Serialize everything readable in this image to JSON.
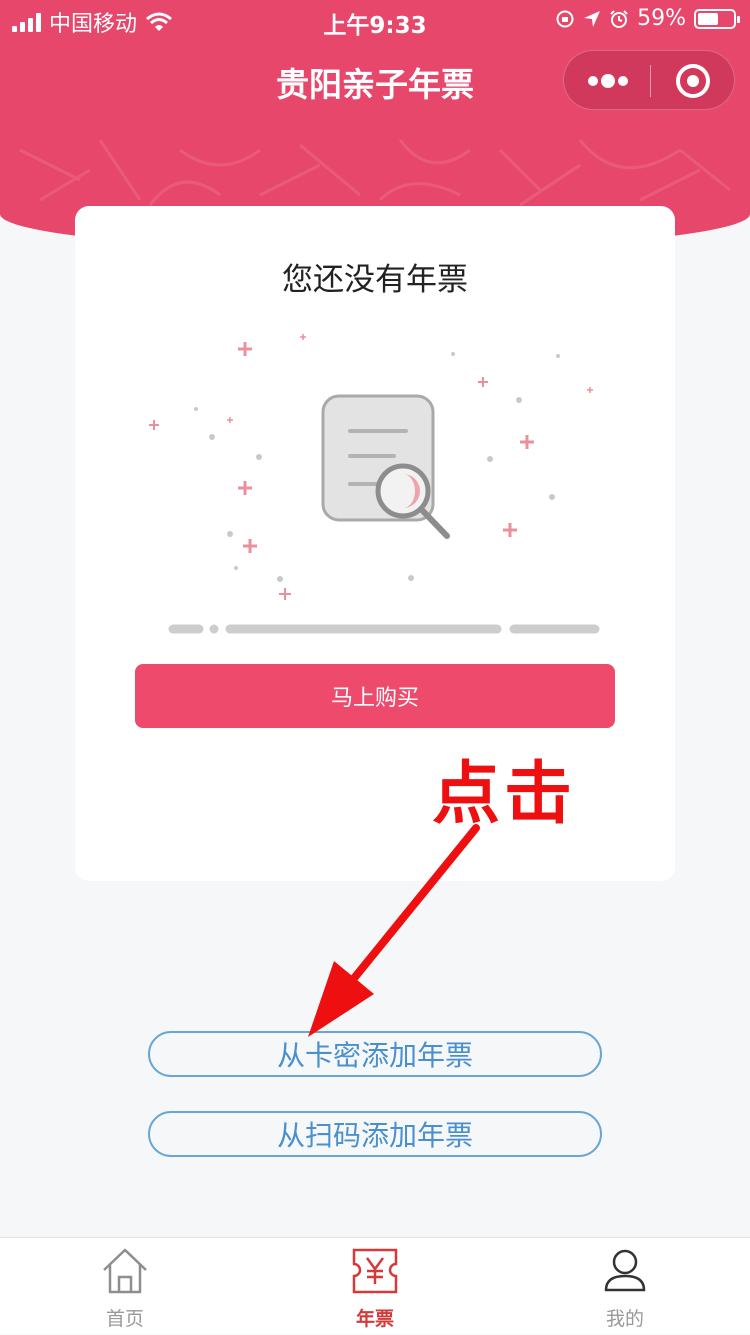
{
  "status_bar": {
    "carrier": "中国移动",
    "time": "上午9:33",
    "battery": "59%",
    "battery_level": 0.59
  },
  "nav": {
    "title": "贵阳亲子年票"
  },
  "card": {
    "title": "您还没有年票",
    "buy_label": "马上购买"
  },
  "annotation": {
    "text": "点击"
  },
  "actions": {
    "add_by_card": "从卡密添加年票",
    "add_by_scan": "从扫码添加年票"
  },
  "tabbar": {
    "items": [
      {
        "label": "首页",
        "icon": "home-icon"
      },
      {
        "label": "年票",
        "icon": "ticket-yen-icon"
      },
      {
        "label": "我的",
        "icon": "user-icon"
      }
    ]
  },
  "colors": {
    "brand": "#e8476c",
    "button": "#ee4a6c",
    "link": "#4a8fce",
    "annotation": "#ee1010",
    "tab_active": "#d43a3a"
  }
}
